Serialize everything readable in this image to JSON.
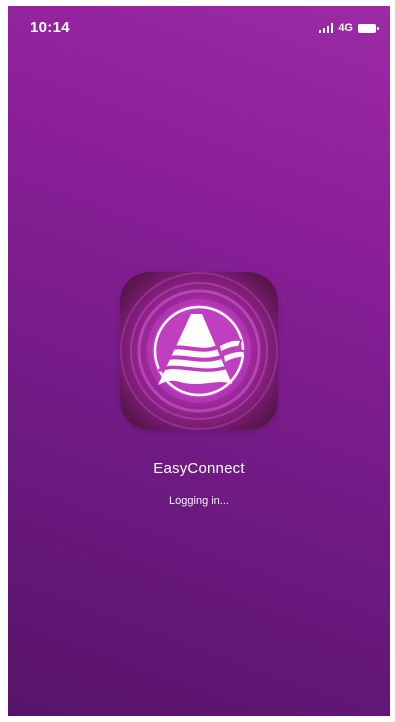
{
  "status_bar": {
    "time": "10:14",
    "network": "4G",
    "icons": [
      "signal-icon",
      "battery-icon"
    ]
  },
  "app": {
    "name": "EasyConnect",
    "icon": "easyconnect-logo-icon"
  },
  "login": {
    "status": "Logging in..."
  },
  "colors": {
    "background_top": "#9c2aa5",
    "background_bottom": "#57136a",
    "icon_center": "#c040c8",
    "icon_edge": "#3a1030"
  }
}
